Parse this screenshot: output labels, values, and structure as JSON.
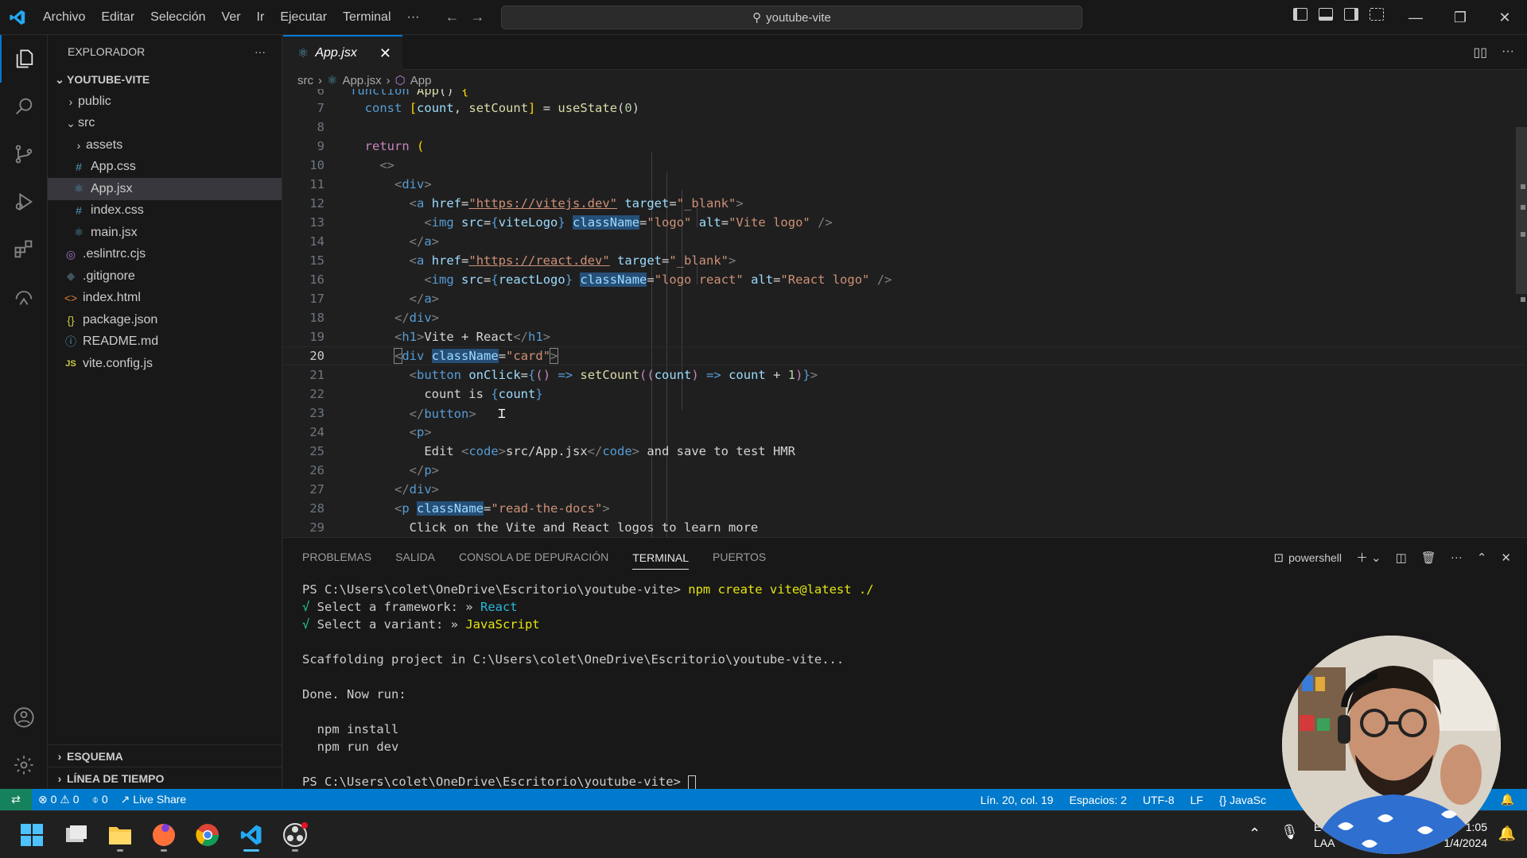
{
  "titlebar": {
    "menu": [
      "Archivo",
      "Editar",
      "Selección",
      "Ver",
      "Ir",
      "Ejecutar",
      "Terminal",
      "···"
    ],
    "search": "youtube-vite"
  },
  "sidebar": {
    "title": "EXPLORADOR",
    "project": "YOUTUBE-VITE",
    "items": [
      {
        "label": "public",
        "kind": "folder",
        "icon": "chevron-right-icon"
      },
      {
        "label": "src",
        "kind": "folder-open",
        "icon": "chevron-down-icon"
      },
      {
        "label": "assets",
        "kind": "folder",
        "icon": "chevron-right-icon"
      },
      {
        "label": "App.css",
        "kind": "css",
        "icon": "#"
      },
      {
        "label": "App.jsx",
        "kind": "jsx",
        "icon": "⚛"
      },
      {
        "label": "index.css",
        "kind": "css",
        "icon": "#"
      },
      {
        "label": "main.jsx",
        "kind": "jsx",
        "icon": "⚛"
      },
      {
        "label": ".eslintrc.cjs",
        "kind": "eslint",
        "icon": "◎"
      },
      {
        "label": ".gitignore",
        "kind": "git",
        "icon": "◆"
      },
      {
        "label": "index.html",
        "kind": "html",
        "icon": "<>"
      },
      {
        "label": "package.json",
        "kind": "json",
        "icon": "{}"
      },
      {
        "label": "README.md",
        "kind": "md",
        "icon": "ⓘ"
      },
      {
        "label": "vite.config.js",
        "kind": "js",
        "icon": "JS"
      }
    ],
    "outline": "ESQUEMA",
    "timeline": "LÍNEA DE TIEMPO"
  },
  "editor": {
    "tab": "App.jsx",
    "breadcrumb": [
      "src",
      "App.jsx",
      "App"
    ],
    "line_numbers": [
      "6",
      "7",
      "8",
      "9",
      "10",
      "11",
      "12",
      "13",
      "14",
      "15",
      "16",
      "17",
      "18",
      "19",
      "20",
      "21",
      "22",
      "23",
      "24",
      "25",
      "26",
      "27",
      "28",
      "29"
    ],
    "current_line": "20"
  },
  "panel": {
    "tabs": [
      "PROBLEMAS",
      "SALIDA",
      "CONSOLA DE DEPURACIÓN",
      "TERMINAL",
      "PUERTOS"
    ],
    "active_tab": "TERMINAL",
    "shell": "powershell",
    "lines": {
      "l1_prompt": "PS C:\\Users\\colet\\OneDrive\\Escritorio\\youtube-vite> ",
      "l1_cmd": "npm create vite@latest ./",
      "l2_check": "√",
      "l2_text": " Select a framework: » ",
      "l2_value": "React",
      "l3_check": "√",
      "l3_text": " Select a variant: » ",
      "l3_value": "JavaScript",
      "l4": "Scaffolding project in C:\\Users\\colet\\OneDrive\\Escritorio\\youtube-vite...",
      "l5": "Done. Now run:",
      "l6": "  npm install",
      "l7": "  npm run dev",
      "l8_prompt": "PS C:\\Users\\colet\\OneDrive\\Escritorio\\youtube-vite> "
    }
  },
  "statusbar": {
    "errors": "0",
    "warnings": "0",
    "ports": "0",
    "liveshare": "Live Share",
    "position": "Lín. 20, col. 19",
    "spaces": "Espacios: 2",
    "encoding": "UTF-8",
    "eol": "LF",
    "language": "JavaSc"
  },
  "taskbar": {
    "clock_time": "1:05",
    "clock_date": "1/4/2024",
    "lang_top": "E",
    "lang_bottom": "LAA"
  },
  "colors": {
    "accent": "#0078d4",
    "statusbar": "#007acc",
    "editor_bg": "#1f1f1f"
  }
}
